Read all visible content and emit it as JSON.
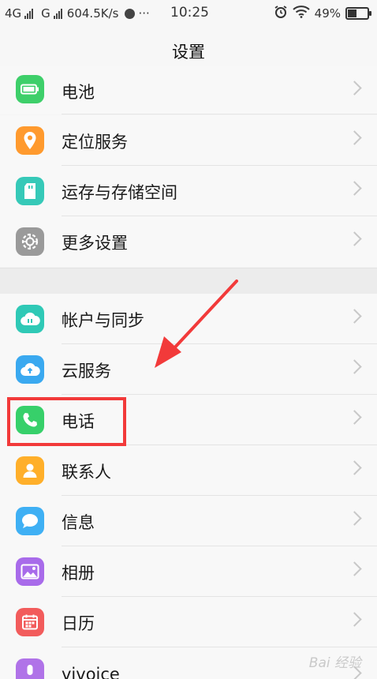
{
  "status_bar": {
    "net1": "4G",
    "net2": "G",
    "speed": "604.5K/s",
    "dots": "···",
    "time": "10:25",
    "battery_text": "49%",
    "battery_level": 0.49
  },
  "header": {
    "title": "设置"
  },
  "group1": [
    {
      "label": "电池",
      "icon": "battery-icon",
      "color": "#3ecf6a"
    },
    {
      "label": "定位服务",
      "icon": "location-pin-icon",
      "color": "#ff9a2e"
    },
    {
      "label": "运存与存储空间",
      "icon": "sd-card-icon",
      "color": "#36c9b8"
    },
    {
      "label": "更多设置",
      "icon": "gear-icon",
      "color": "#9a9a9a"
    }
  ],
  "group2": [
    {
      "label": "帐户与同步",
      "icon": "cloud-sync-icon",
      "color": "#2fc9b6"
    },
    {
      "label": "云服务",
      "icon": "cloud-icon",
      "color": "#3aa9f0"
    },
    {
      "label": "电话",
      "icon": "phone-icon",
      "color": "#37d06a"
    },
    {
      "label": "联系人",
      "icon": "contact-icon",
      "color": "#ffaf2a"
    },
    {
      "label": "信息",
      "icon": "message-icon",
      "color": "#3fb0f4"
    },
    {
      "label": "相册",
      "icon": "photo-icon",
      "color": "#a86bea"
    },
    {
      "label": "日历",
      "icon": "calendar-icon",
      "color": "#f25c5c"
    },
    {
      "label": "vivoice",
      "icon": "microphone-icon",
      "color": "#b073e8"
    }
  ],
  "watermark": "Bai 经验"
}
